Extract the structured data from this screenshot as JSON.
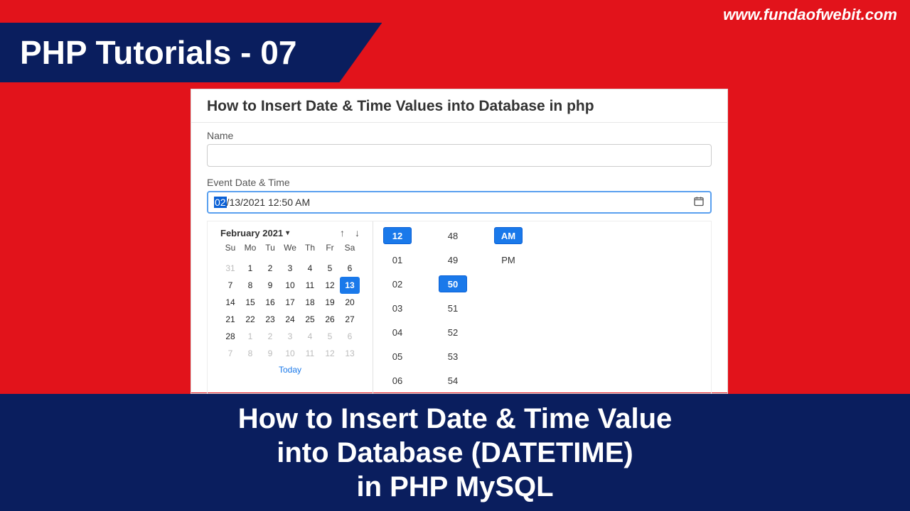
{
  "url": "www.fundaofwebit.com",
  "banner_title": "PHP Tutorials - 07",
  "card": {
    "title": "How to Insert Date & Time Values into Database in php",
    "name_label": "Name",
    "event_label": "Event Date & Time",
    "dt_mh": "02",
    "dt_rest": "/13/2021 12:50 AM"
  },
  "calendar": {
    "month": "February 2021",
    "weekdays": [
      "Su",
      "Mo",
      "Tu",
      "We",
      "Th",
      "Fr",
      "Sa"
    ],
    "cells": [
      {
        "v": "31",
        "m": true
      },
      {
        "v": "1"
      },
      {
        "v": "2"
      },
      {
        "v": "3"
      },
      {
        "v": "4"
      },
      {
        "v": "5"
      },
      {
        "v": "6"
      },
      {
        "v": "7"
      },
      {
        "v": "8"
      },
      {
        "v": "9"
      },
      {
        "v": "10"
      },
      {
        "v": "11"
      },
      {
        "v": "12"
      },
      {
        "v": "13",
        "s": true
      },
      {
        "v": "14"
      },
      {
        "v": "15"
      },
      {
        "v": "16"
      },
      {
        "v": "17"
      },
      {
        "v": "18"
      },
      {
        "v": "19"
      },
      {
        "v": "20"
      },
      {
        "v": "21"
      },
      {
        "v": "22"
      },
      {
        "v": "23"
      },
      {
        "v": "24"
      },
      {
        "v": "25"
      },
      {
        "v": "26"
      },
      {
        "v": "27"
      },
      {
        "v": "28"
      },
      {
        "v": "1",
        "m": true
      },
      {
        "v": "2",
        "m": true
      },
      {
        "v": "3",
        "m": true
      },
      {
        "v": "4",
        "m": true
      },
      {
        "v": "5",
        "m": true
      },
      {
        "v": "6",
        "m": true
      },
      {
        "v": "7",
        "m": true
      },
      {
        "v": "8",
        "m": true
      },
      {
        "v": "9",
        "m": true
      },
      {
        "v": "10",
        "m": true
      },
      {
        "v": "11",
        "m": true
      },
      {
        "v": "12",
        "m": true
      },
      {
        "v": "13",
        "m": true
      }
    ],
    "today": "Today"
  },
  "time": {
    "hours": [
      {
        "v": "12",
        "s": true
      },
      {
        "v": "01"
      },
      {
        "v": "02"
      },
      {
        "v": "03"
      },
      {
        "v": "04"
      },
      {
        "v": "05"
      },
      {
        "v": "06"
      }
    ],
    "minutes": [
      {
        "v": "48"
      },
      {
        "v": "49"
      },
      {
        "v": "50",
        "s": true
      },
      {
        "v": "51"
      },
      {
        "v": "52"
      },
      {
        "v": "53"
      },
      {
        "v": "54"
      }
    ],
    "ampm": [
      {
        "v": "AM",
        "s": true
      },
      {
        "v": "PM"
      }
    ]
  },
  "bottom": [
    "How to Insert Date & Time Value",
    "into Database (DATETIME)",
    "in PHP MySQL"
  ]
}
